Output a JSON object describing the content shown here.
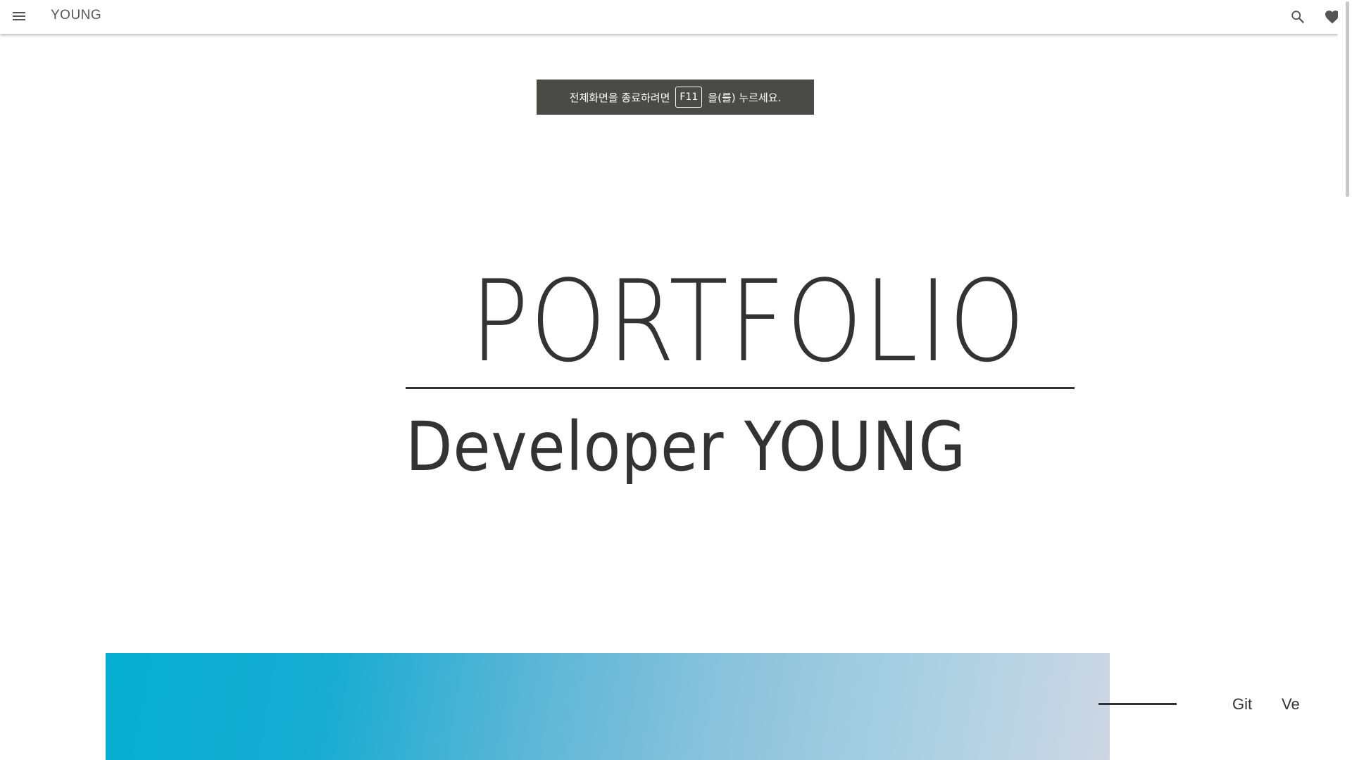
{
  "header": {
    "brand": "YOUNG"
  },
  "fullscreen_notice": {
    "before": "전체화면을 종료하려면",
    "key": "F11",
    "after": "을(를) 누르세요."
  },
  "hero": {
    "title": "PORTFOLIO",
    "subtitle": "Developer YOUNG"
  },
  "side_nav": {
    "items": [
      "Git",
      "Ve"
    ]
  },
  "colors": {
    "text": "#333333",
    "toast_bg": "#4a4a47",
    "banner_start": "#05aed0",
    "banner_end": "#cdd6e3"
  }
}
